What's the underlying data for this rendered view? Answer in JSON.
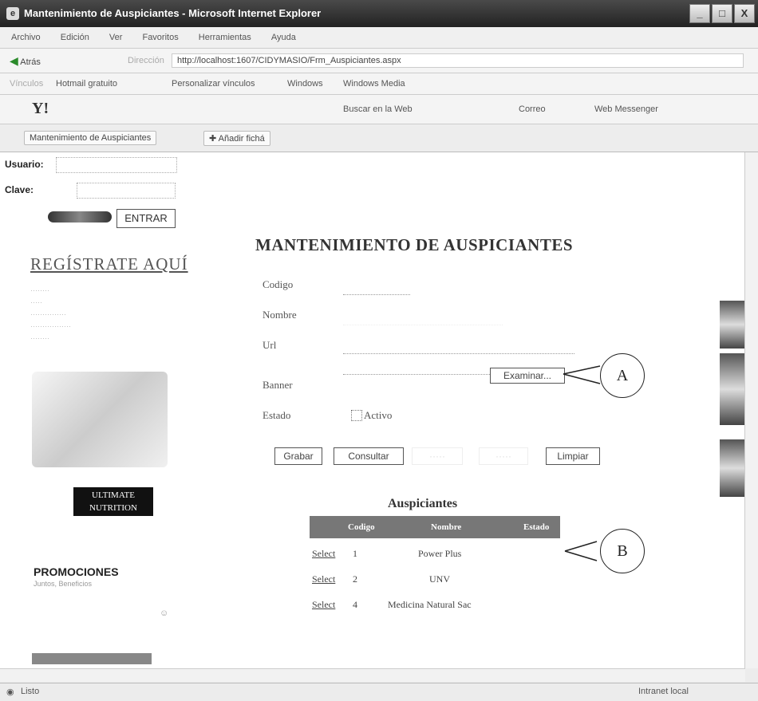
{
  "window": {
    "title": "Mantenimiento de Auspiciantes - Microsoft Internet Explorer",
    "controls": [
      "_",
      "□",
      "X"
    ]
  },
  "menubar": [
    "Archivo",
    "Edición",
    "Ver",
    "Favoritos",
    "Herramientas",
    "Ayuda"
  ],
  "navbar": {
    "back_label": "Atrás",
    "address_label": "Dirección",
    "address": "http://localhost:1607/CIDYMASIO/Frm_Auspiciantes.aspx"
  },
  "linksbar": {
    "vinculos_label": "Vínculos",
    "links": [
      "Hotmail gratuito",
      "Personalizar vínculos",
      "Windows",
      "Windows Media"
    ]
  },
  "yahoobar": {
    "logo": "Y!",
    "search_label": "Buscar en la Web",
    "correo_label": "Correo",
    "messenger_label": "Web Messenger"
  },
  "tabbar": {
    "tab_label": "Mantenimiento de Auspiciantes",
    "add_favorite_label": "Añadir fichá"
  },
  "sidebar": {
    "user_label": "Usuario:",
    "pass_label": "Clave:",
    "login_button": "ENTRAR",
    "register_link": "REGÍSTRATE AQUÍ",
    "promo_title": "PROMOCIONES",
    "promo_sub": "Juntos, Beneficios",
    "brand": "ULTIMATE NUTRITION",
    "brand_line1": "ULTIMATE",
    "brand_line2": "NUTRITION"
  },
  "main": {
    "heading": "MANTENIMIENTO DE AUSPICIANTES",
    "fields": {
      "codigo_label": "Codigo",
      "nombre_label": "Nombre",
      "url_label": "Url",
      "banner_label": "Banner",
      "estado_label": "Estado",
      "activo_label": "Activo",
      "examinar_button": "Examinar..."
    },
    "buttons": {
      "grabar": "Grabar",
      "consultar": "Consultar",
      "limpiar": "Limpiar"
    }
  },
  "table": {
    "title": "Auspiciantes",
    "headers": [
      "Codigo",
      "Nombre",
      "Estado"
    ],
    "select_label": "Select",
    "rows": [
      {
        "codigo": "1",
        "nombre": "Power Plus"
      },
      {
        "codigo": "2",
        "nombre": "UNV"
      },
      {
        "codigo": "4",
        "nombre": "Medicina Natural Sac"
      }
    ]
  },
  "callouts": {
    "a": "A",
    "b": "B"
  },
  "statusbar": {
    "left": "Listo",
    "right": "Intranet local"
  }
}
